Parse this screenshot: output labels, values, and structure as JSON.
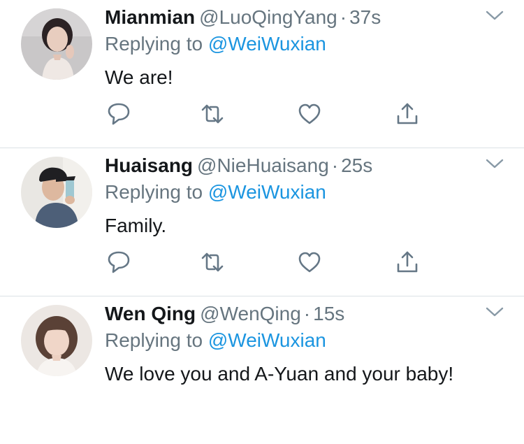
{
  "colors": {
    "text": "#14171a",
    "secondary": "#66757f",
    "link": "#1b95e0",
    "divider": "#dbe1e6",
    "icon": "#657786"
  },
  "tweets": [
    {
      "name": "Mianmian",
      "handle": "@LuoQingYang",
      "dot": "·",
      "time": "37s",
      "replying_prefix": "Replying to",
      "replying_to": "@WeiWuxian",
      "text": "We are!",
      "avatar": "avatar-photo"
    },
    {
      "name": "Huaisang",
      "handle": "@NieHuaisang",
      "dot": "·",
      "time": "25s",
      "replying_prefix": "Replying to",
      "replying_to": "@WeiWuxian",
      "text": "Family.",
      "avatar": "avatar-photo"
    },
    {
      "name": "Wen Qing",
      "handle": "@WenQing",
      "dot": "·",
      "time": "15s",
      "replying_prefix": "Replying to",
      "replying_to": "@WeiWuxian",
      "text": "We love you and A-Yuan and your baby!",
      "avatar": "avatar-photo"
    }
  ],
  "icons": {
    "reply": "reply-icon",
    "retweet": "retweet-icon",
    "like": "heart-icon",
    "share": "share-icon",
    "more": "chevron-down-icon"
  }
}
